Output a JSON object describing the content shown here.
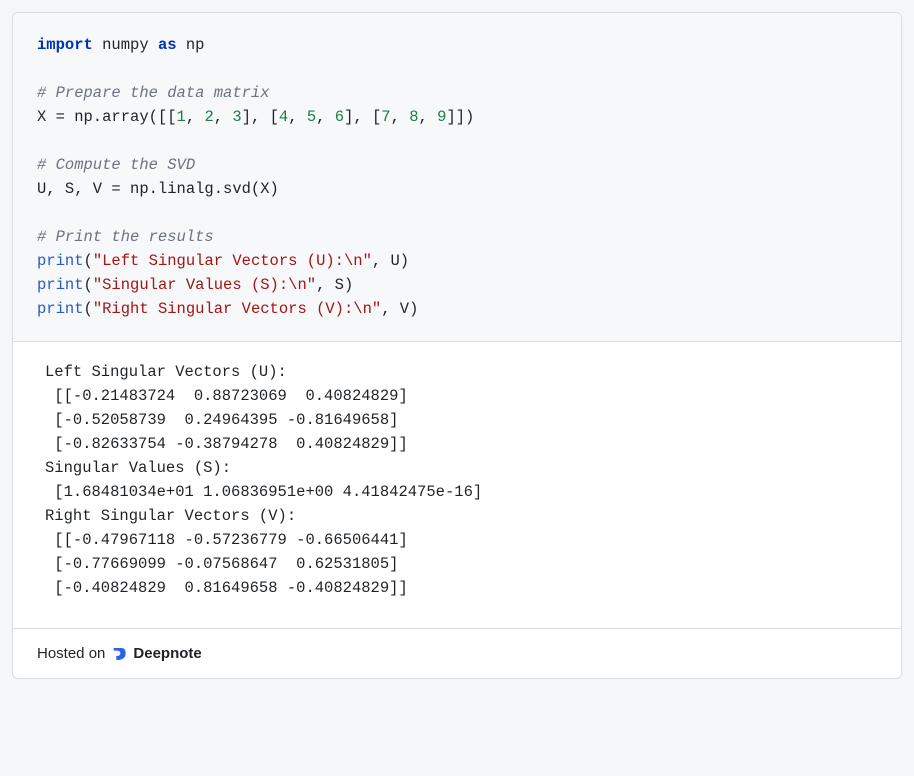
{
  "code": {
    "tokens": [
      [
        [
          "import ",
          "kw"
        ],
        [
          "numpy ",
          "id"
        ],
        [
          "as ",
          "kw"
        ],
        [
          "np",
          "id"
        ]
      ],
      [],
      [
        [
          "# Prepare the data matrix",
          "cm"
        ]
      ],
      [
        [
          "X = np.array([[",
          "id"
        ],
        [
          "1",
          "num"
        ],
        [
          ", ",
          "id"
        ],
        [
          "2",
          "num"
        ],
        [
          ", ",
          "id"
        ],
        [
          "3",
          "num"
        ],
        [
          "], [",
          "id"
        ],
        [
          "4",
          "num"
        ],
        [
          ", ",
          "id"
        ],
        [
          "5",
          "num"
        ],
        [
          ", ",
          "id"
        ],
        [
          "6",
          "num"
        ],
        [
          "], [",
          "id"
        ],
        [
          "7",
          "num"
        ],
        [
          ", ",
          "id"
        ],
        [
          "8",
          "num"
        ],
        [
          ", ",
          "id"
        ],
        [
          "9",
          "num"
        ],
        [
          "]])",
          "id"
        ]
      ],
      [],
      [
        [
          "# Compute the SVD",
          "cm"
        ]
      ],
      [
        [
          "U, S, V = np.linalg.svd(X)",
          "id"
        ]
      ],
      [],
      [
        [
          "# Print the results",
          "cm"
        ]
      ],
      [
        [
          "print",
          "fn"
        ],
        [
          "(",
          "id"
        ],
        [
          "\"Left Singular Vectors (U):\\n\"",
          "str"
        ],
        [
          ", U)",
          "id"
        ]
      ],
      [
        [
          "print",
          "fn"
        ],
        [
          "(",
          "id"
        ],
        [
          "\"Singular Values (S):\\n\"",
          "str"
        ],
        [
          ", S)",
          "id"
        ]
      ],
      [
        [
          "print",
          "fn"
        ],
        [
          "(",
          "id"
        ],
        [
          "\"Right Singular Vectors (V):\\n\"",
          "str"
        ],
        [
          ", V)",
          "id"
        ]
      ]
    ]
  },
  "output_lines": [
    "Left Singular Vectors (U):",
    " [[-0.21483724  0.88723069  0.40824829]",
    " [-0.52058739  0.24964395 -0.81649658]",
    " [-0.82633754 -0.38794278  0.40824829]]",
    "Singular Values (S):",
    " [1.68481034e+01 1.06836951e+00 4.41842475e-16]",
    "Right Singular Vectors (V):",
    " [[-0.47967118 -0.57236779 -0.66506441]",
    " [-0.77669099 -0.07568647  0.62531805]",
    " [-0.40824829  0.81649658 -0.40824829]]"
  ],
  "footer": {
    "prefix": "Hosted on ",
    "brand": "Deepnote"
  }
}
